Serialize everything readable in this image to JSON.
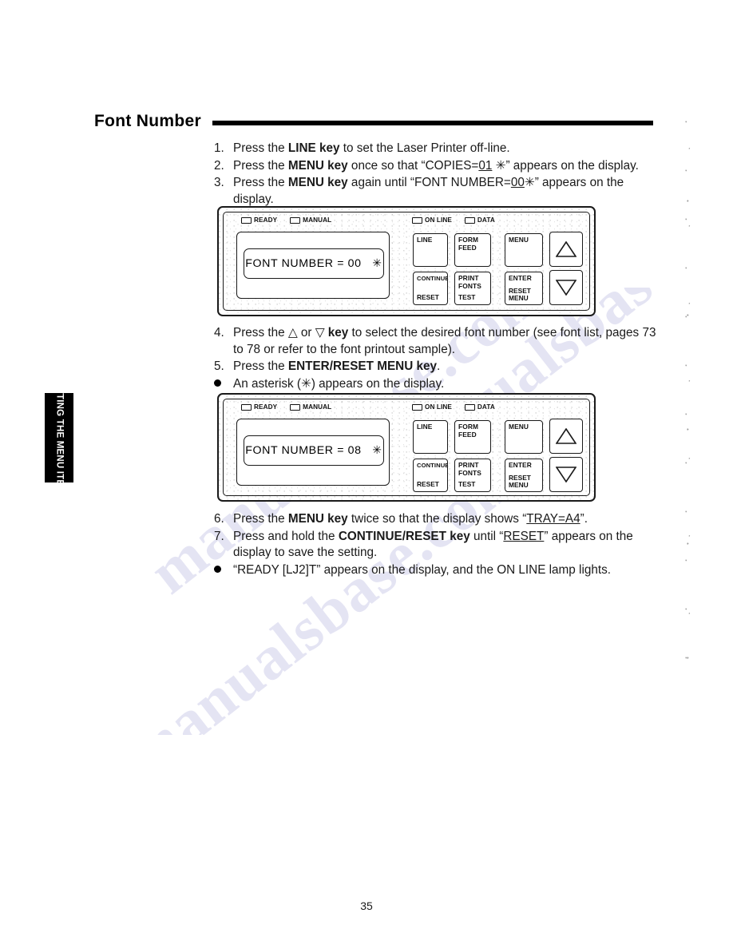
{
  "document": {
    "heading": "Font Number",
    "page_number": "35",
    "side_tab": "SETTING THE MENU ITEMS",
    "watermark": "manualsbase.com"
  },
  "steps_group_1": [
    {
      "marker": "1.",
      "type": "number",
      "parts": [
        {
          "text": "Press the ",
          "style": "normal"
        },
        {
          "text": "LINE key",
          "style": "bold"
        },
        {
          "text": " to set the Laser Printer off-line.",
          "style": "normal"
        }
      ]
    },
    {
      "marker": "2.",
      "type": "number",
      "parts": [
        {
          "text": "Press the ",
          "style": "normal"
        },
        {
          "text": "MENU key",
          "style": "bold"
        },
        {
          "text": " once so that “COPIES=",
          "style": "normal"
        },
        {
          "text": "01",
          "style": "underline"
        },
        {
          "text": " ✳” appears on the display.",
          "style": "normal"
        }
      ]
    },
    {
      "marker": "3.",
      "type": "number",
      "parts": [
        {
          "text": "Press the ",
          "style": "normal"
        },
        {
          "text": "MENU key",
          "style": "bold"
        },
        {
          "text": " again until “FONT NUMBER=",
          "style": "normal"
        },
        {
          "text": "00",
          "style": "underline"
        },
        {
          "text": "✳” appears on the display.",
          "style": "normal"
        }
      ]
    }
  ],
  "steps_group_2": [
    {
      "marker": "4.",
      "type": "number",
      "parts": [
        {
          "text": "Press the △ or ▽ ",
          "style": "normal"
        },
        {
          "text": "key",
          "style": "bold"
        },
        {
          "text": " to select the desired font number (see font list, pages 73 to 78 or refer to the font printout sample).",
          "style": "normal"
        }
      ]
    },
    {
      "marker": "5.",
      "type": "number",
      "parts": [
        {
          "text": "Press the ",
          "style": "normal"
        },
        {
          "text": "ENTER/RESET MENU key",
          "style": "bold"
        },
        {
          "text": ".",
          "style": "normal"
        }
      ]
    },
    {
      "marker": "●",
      "type": "bullet",
      "parts": [
        {
          "text": "An asterisk (✳) appears on the display.",
          "style": "normal"
        }
      ]
    }
  ],
  "steps_group_3": [
    {
      "marker": "6.",
      "type": "number",
      "parts": [
        {
          "text": "Press the ",
          "style": "normal"
        },
        {
          "text": "MENU key",
          "style": "bold"
        },
        {
          "text": " twice so that the display shows “",
          "style": "normal"
        },
        {
          "text": "TRAY=A4",
          "style": "underline"
        },
        {
          "text": "”.",
          "style": "normal"
        }
      ]
    },
    {
      "marker": "7.",
      "type": "number",
      "parts": [
        {
          "text": "Press and hold the ",
          "style": "normal"
        },
        {
          "text": "CONTINUE/RESET key",
          "style": "bold"
        },
        {
          "text": " until “",
          "style": "normal"
        },
        {
          "text": "RESET",
          "style": "underline"
        },
        {
          "text": "” appears on the display to save the setting.",
          "style": "normal"
        }
      ]
    },
    {
      "marker": "●",
      "type": "bullet",
      "parts": [
        {
          "text": "“READY [LJ2]T” appears on the display, and the ON LINE lamp lights.",
          "style": "normal"
        }
      ]
    }
  ],
  "panels": [
    {
      "id": "panel-1",
      "display_text": "FONT NUMBER = 00   ✳",
      "leds_left": [
        "READY",
        "MANUAL"
      ],
      "leds_right": [
        "ON LINE",
        "DATA"
      ],
      "buttons": [
        {
          "name": "line",
          "top_lines": [
            "LINE"
          ],
          "bottom": ""
        },
        {
          "name": "form-feed",
          "top_lines": [
            "FORM",
            "FEED"
          ],
          "bottom": ""
        },
        {
          "name": "menu",
          "top_lines": [
            "MENU"
          ],
          "bottom": ""
        },
        {
          "name": "up-arrow",
          "top_lines": [],
          "bottom": "",
          "icon": "triangle-up-icon"
        },
        {
          "name": "continue-reset",
          "top_lines": [
            "CONTINUE"
          ],
          "bottom": "RESET"
        },
        {
          "name": "print-fonts-test",
          "top_lines": [
            "PRINT",
            "FONTS"
          ],
          "bottom": "TEST"
        },
        {
          "name": "enter-reset-menu",
          "top_lines": [
            "ENTER"
          ],
          "bottom": "RESET\nMENU"
        },
        {
          "name": "down-arrow",
          "top_lines": [],
          "bottom": "",
          "icon": "triangle-down-icon"
        }
      ]
    },
    {
      "id": "panel-2",
      "display_text": "FONT NUMBER = 08   ✳",
      "leds_left": [
        "READY",
        "MANUAL"
      ],
      "leds_right": [
        "ON LINE",
        "DATA"
      ],
      "buttons": [
        {
          "name": "line",
          "top_lines": [
            "LINE"
          ],
          "bottom": ""
        },
        {
          "name": "form-feed",
          "top_lines": [
            "FORM",
            "FEED"
          ],
          "bottom": ""
        },
        {
          "name": "menu",
          "top_lines": [
            "MENU"
          ],
          "bottom": ""
        },
        {
          "name": "up-arrow",
          "top_lines": [],
          "bottom": "",
          "icon": "triangle-up-icon"
        },
        {
          "name": "continue-reset",
          "top_lines": [
            "CONTINUE"
          ],
          "bottom": "RESET"
        },
        {
          "name": "print-fonts-test",
          "top_lines": [
            "PRINT",
            "FONTS"
          ],
          "bottom": "TEST"
        },
        {
          "name": "enter-reset-menu",
          "top_lines": [
            "ENTER"
          ],
          "bottom": "RESET\nMENU"
        },
        {
          "name": "down-arrow",
          "top_lines": [],
          "bottom": "",
          "icon": "triangle-down-icon"
        }
      ]
    }
  ]
}
